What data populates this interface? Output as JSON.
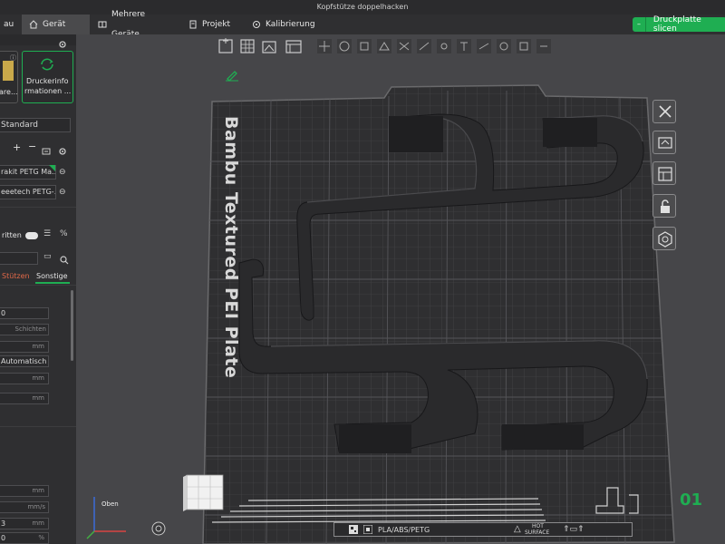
{
  "window": {
    "title": "Kopfstütze doppelhacken"
  },
  "tabs": [
    {
      "label": "au",
      "icon": ""
    },
    {
      "label": "Gerät",
      "icon": "home-icon",
      "active": true
    },
    {
      "label": "Mehrere Geräte",
      "icon": "multi-device-icon"
    },
    {
      "label": "Projekt",
      "icon": "project-icon"
    },
    {
      "label": "Kalibrierung",
      "icon": "calibration-icon"
    }
  ],
  "slice_button": {
    "label": "Druckplatte slicen",
    "color": "#1fae52"
  },
  "sidebar": {
    "printer_card_left": "are...",
    "printer_info": {
      "line1": "Druckerinfo",
      "line2": "rmationen ..."
    },
    "plate_type": "Standard",
    "filaments": [
      {
        "label": "rakit PETG Ma..."
      },
      {
        "label": "eeetech PETG-..."
      }
    ],
    "advanced_label": "ritten",
    "section_tabs": [
      {
        "label": "Stützen",
        "active": false
      },
      {
        "label": "Sonstige",
        "active": true
      }
    ],
    "fields": [
      {
        "value": "0",
        "unit": ""
      },
      {
        "value": "",
        "unit": "Schichten"
      },
      {
        "value": "",
        "unit": "mm"
      },
      {
        "value": "Automatisch",
        "unit": ""
      },
      {
        "value": "",
        "unit": "mm"
      },
      {
        "value": "",
        "unit": "mm"
      },
      {
        "value": "",
        "unit": "mm"
      },
      {
        "value": "",
        "unit": "mm/s"
      },
      {
        "value": "3",
        "unit": "mm"
      },
      {
        "value": "0",
        "unit": "%"
      }
    ]
  },
  "viewport": {
    "plate_name": "Bambu Textured PEI Plate",
    "plate_number": "01",
    "filament_strip": "PLA/ABS/PETG",
    "hot_surface": {
      "line1": "HOT",
      "line2": "SURFACE"
    },
    "view_cube_label": "Oben",
    "accent": "#1fae52"
  }
}
